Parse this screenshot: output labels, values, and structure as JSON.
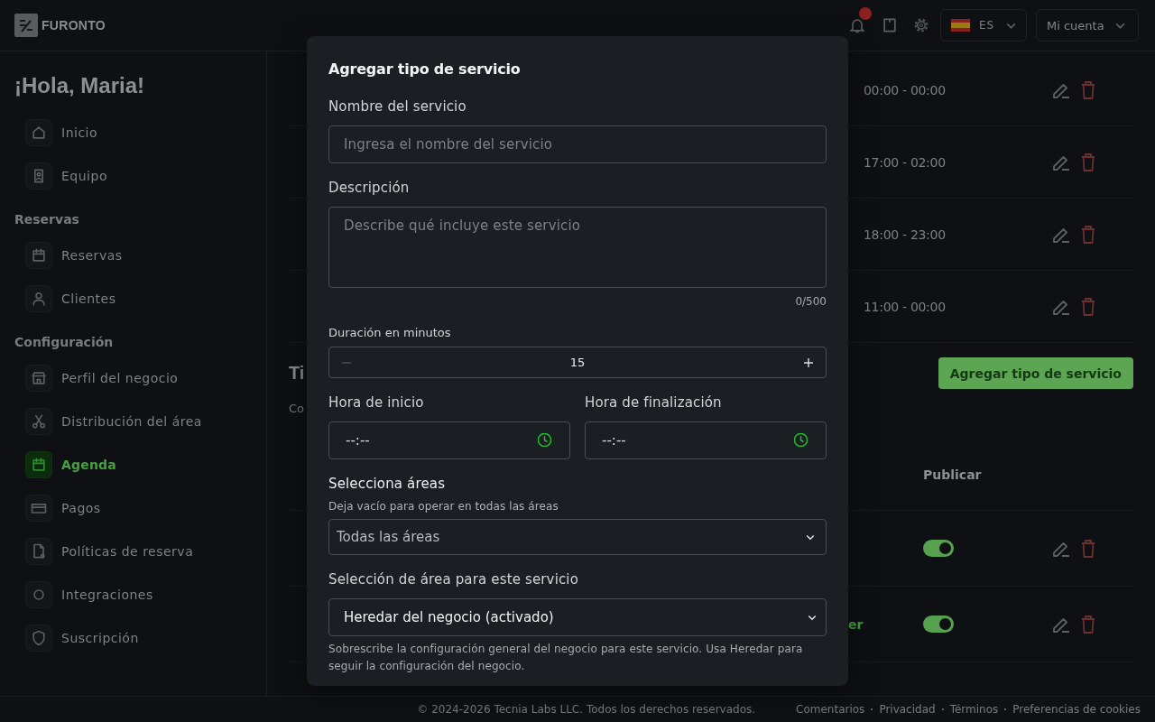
{
  "header": {
    "brand": "FURONTO",
    "has_notifications": true,
    "language": "ES",
    "account": "Mi cuenta"
  },
  "sidebar": {
    "greeting": "¡Hola, Maria!",
    "groups": [
      {
        "items": [
          {
            "label": "Inicio",
            "selected": false
          },
          {
            "label": "Equipo",
            "selected": false
          }
        ]
      },
      {
        "title": "Reservas",
        "items": [
          {
            "label": "Reservas",
            "selected": false
          },
          {
            "label": "Clientes",
            "selected": false
          }
        ]
      },
      {
        "title": "Configuración",
        "items": [
          {
            "label": "Perfil del negocio",
            "selected": false
          },
          {
            "label": "Distribución del área",
            "selected": false
          },
          {
            "label": "Agenda",
            "selected": true
          },
          {
            "label": "Pagos",
            "selected": false
          },
          {
            "label": "Políticas de reserva",
            "selected": false
          },
          {
            "label": "Integraciones",
            "selected": false
          },
          {
            "label": "Suscripción",
            "selected": false
          }
        ]
      }
    ]
  },
  "schedule": {
    "rows": [
      {
        "hours": "00:00 - 00:00"
      },
      {
        "hours": "17:00 - 02:00"
      },
      {
        "hours": "18:00 - 23:00"
      },
      {
        "hours": "11:00 - 00:00"
      }
    ]
  },
  "services": {
    "title": "Ti",
    "subtitle": "Co",
    "add_button": "Agregar tipo de servicio",
    "columns": [
      "Publicar"
    ],
    "rows": [
      {
        "published": true
      },
      {
        "column_1": "er",
        "published": true
      }
    ]
  },
  "footer": {
    "copyright": "© 2024-2026 Tecnia Labs LLC. Todos los derechos reservados.",
    "links": [
      "Comentarios",
      "Privacidad",
      "Términos",
      "Preferencias de cookies"
    ]
  },
  "modal": {
    "title": "Agregar tipo de servicio",
    "name": {
      "label": "Nombre del servicio",
      "placeholder": "Ingresa el nombre del servicio"
    },
    "description": {
      "label": "Descripción",
      "placeholder": "Describe qué incluye este servicio",
      "counter": "0/500"
    },
    "duration": {
      "label": "Duración en minutos",
      "value": "15",
      "decrease_disabled": true
    },
    "times": [
      {
        "label": "Hora de inicio",
        "placeholder": "--:--"
      },
      {
        "label": "Hora de finalización",
        "placeholder": "--:--"
      }
    ],
    "areas": {
      "label": "Selecciona áreas",
      "hint": "Deja vacío para operar en todas las áreas",
      "placeholder": "Todas las áreas"
    },
    "area_mode": {
      "label": "Selección de área para este servicio",
      "value": "Heredar del negocio (activado)",
      "help": "Sobrescribe la configuración general del negocio para este servicio. Usa Heredar para seguir la configuración del negocio."
    }
  }
}
